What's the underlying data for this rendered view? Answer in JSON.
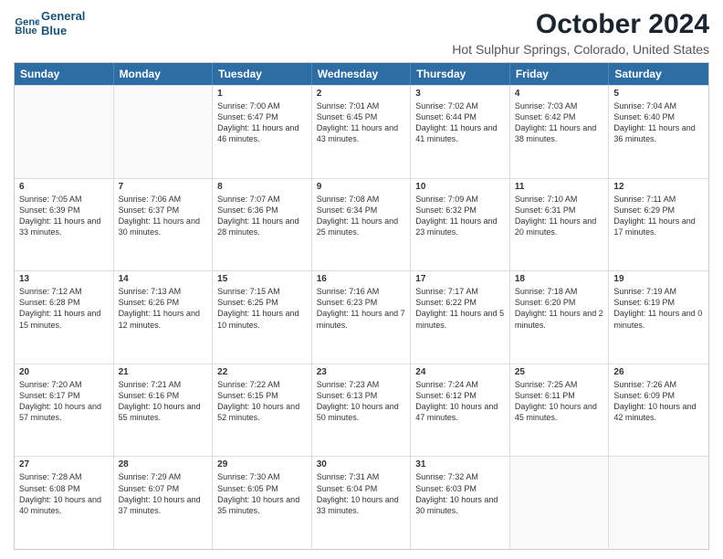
{
  "header": {
    "logo_line1": "General",
    "logo_line2": "Blue",
    "month": "October 2024",
    "location": "Hot Sulphur Springs, Colorado, United States"
  },
  "weekdays": [
    "Sunday",
    "Monday",
    "Tuesday",
    "Wednesday",
    "Thursday",
    "Friday",
    "Saturday"
  ],
  "rows": [
    [
      {
        "day": "",
        "sunrise": "",
        "sunset": "",
        "daylight": ""
      },
      {
        "day": "",
        "sunrise": "",
        "sunset": "",
        "daylight": ""
      },
      {
        "day": "1",
        "sunrise": "Sunrise: 7:00 AM",
        "sunset": "Sunset: 6:47 PM",
        "daylight": "Daylight: 11 hours and 46 minutes."
      },
      {
        "day": "2",
        "sunrise": "Sunrise: 7:01 AM",
        "sunset": "Sunset: 6:45 PM",
        "daylight": "Daylight: 11 hours and 43 minutes."
      },
      {
        "day": "3",
        "sunrise": "Sunrise: 7:02 AM",
        "sunset": "Sunset: 6:44 PM",
        "daylight": "Daylight: 11 hours and 41 minutes."
      },
      {
        "day": "4",
        "sunrise": "Sunrise: 7:03 AM",
        "sunset": "Sunset: 6:42 PM",
        "daylight": "Daylight: 11 hours and 38 minutes."
      },
      {
        "day": "5",
        "sunrise": "Sunrise: 7:04 AM",
        "sunset": "Sunset: 6:40 PM",
        "daylight": "Daylight: 11 hours and 36 minutes."
      }
    ],
    [
      {
        "day": "6",
        "sunrise": "Sunrise: 7:05 AM",
        "sunset": "Sunset: 6:39 PM",
        "daylight": "Daylight: 11 hours and 33 minutes."
      },
      {
        "day": "7",
        "sunrise": "Sunrise: 7:06 AM",
        "sunset": "Sunset: 6:37 PM",
        "daylight": "Daylight: 11 hours and 30 minutes."
      },
      {
        "day": "8",
        "sunrise": "Sunrise: 7:07 AM",
        "sunset": "Sunset: 6:36 PM",
        "daylight": "Daylight: 11 hours and 28 minutes."
      },
      {
        "day": "9",
        "sunrise": "Sunrise: 7:08 AM",
        "sunset": "Sunset: 6:34 PM",
        "daylight": "Daylight: 11 hours and 25 minutes."
      },
      {
        "day": "10",
        "sunrise": "Sunrise: 7:09 AM",
        "sunset": "Sunset: 6:32 PM",
        "daylight": "Daylight: 11 hours and 23 minutes."
      },
      {
        "day": "11",
        "sunrise": "Sunrise: 7:10 AM",
        "sunset": "Sunset: 6:31 PM",
        "daylight": "Daylight: 11 hours and 20 minutes."
      },
      {
        "day": "12",
        "sunrise": "Sunrise: 7:11 AM",
        "sunset": "Sunset: 6:29 PM",
        "daylight": "Daylight: 11 hours and 17 minutes."
      }
    ],
    [
      {
        "day": "13",
        "sunrise": "Sunrise: 7:12 AM",
        "sunset": "Sunset: 6:28 PM",
        "daylight": "Daylight: 11 hours and 15 minutes."
      },
      {
        "day": "14",
        "sunrise": "Sunrise: 7:13 AM",
        "sunset": "Sunset: 6:26 PM",
        "daylight": "Daylight: 11 hours and 12 minutes."
      },
      {
        "day": "15",
        "sunrise": "Sunrise: 7:15 AM",
        "sunset": "Sunset: 6:25 PM",
        "daylight": "Daylight: 11 hours and 10 minutes."
      },
      {
        "day": "16",
        "sunrise": "Sunrise: 7:16 AM",
        "sunset": "Sunset: 6:23 PM",
        "daylight": "Daylight: 11 hours and 7 minutes."
      },
      {
        "day": "17",
        "sunrise": "Sunrise: 7:17 AM",
        "sunset": "Sunset: 6:22 PM",
        "daylight": "Daylight: 11 hours and 5 minutes."
      },
      {
        "day": "18",
        "sunrise": "Sunrise: 7:18 AM",
        "sunset": "Sunset: 6:20 PM",
        "daylight": "Daylight: 11 hours and 2 minutes."
      },
      {
        "day": "19",
        "sunrise": "Sunrise: 7:19 AM",
        "sunset": "Sunset: 6:19 PM",
        "daylight": "Daylight: 11 hours and 0 minutes."
      }
    ],
    [
      {
        "day": "20",
        "sunrise": "Sunrise: 7:20 AM",
        "sunset": "Sunset: 6:17 PM",
        "daylight": "Daylight: 10 hours and 57 minutes."
      },
      {
        "day": "21",
        "sunrise": "Sunrise: 7:21 AM",
        "sunset": "Sunset: 6:16 PM",
        "daylight": "Daylight: 10 hours and 55 minutes."
      },
      {
        "day": "22",
        "sunrise": "Sunrise: 7:22 AM",
        "sunset": "Sunset: 6:15 PM",
        "daylight": "Daylight: 10 hours and 52 minutes."
      },
      {
        "day": "23",
        "sunrise": "Sunrise: 7:23 AM",
        "sunset": "Sunset: 6:13 PM",
        "daylight": "Daylight: 10 hours and 50 minutes."
      },
      {
        "day": "24",
        "sunrise": "Sunrise: 7:24 AM",
        "sunset": "Sunset: 6:12 PM",
        "daylight": "Daylight: 10 hours and 47 minutes."
      },
      {
        "day": "25",
        "sunrise": "Sunrise: 7:25 AM",
        "sunset": "Sunset: 6:11 PM",
        "daylight": "Daylight: 10 hours and 45 minutes."
      },
      {
        "day": "26",
        "sunrise": "Sunrise: 7:26 AM",
        "sunset": "Sunset: 6:09 PM",
        "daylight": "Daylight: 10 hours and 42 minutes."
      }
    ],
    [
      {
        "day": "27",
        "sunrise": "Sunrise: 7:28 AM",
        "sunset": "Sunset: 6:08 PM",
        "daylight": "Daylight: 10 hours and 40 minutes."
      },
      {
        "day": "28",
        "sunrise": "Sunrise: 7:29 AM",
        "sunset": "Sunset: 6:07 PM",
        "daylight": "Daylight: 10 hours and 37 minutes."
      },
      {
        "day": "29",
        "sunrise": "Sunrise: 7:30 AM",
        "sunset": "Sunset: 6:05 PM",
        "daylight": "Daylight: 10 hours and 35 minutes."
      },
      {
        "day": "30",
        "sunrise": "Sunrise: 7:31 AM",
        "sunset": "Sunset: 6:04 PM",
        "daylight": "Daylight: 10 hours and 33 minutes."
      },
      {
        "day": "31",
        "sunrise": "Sunrise: 7:32 AM",
        "sunset": "Sunset: 6:03 PM",
        "daylight": "Daylight: 10 hours and 30 minutes."
      },
      {
        "day": "",
        "sunrise": "",
        "sunset": "",
        "daylight": ""
      },
      {
        "day": "",
        "sunrise": "",
        "sunset": "",
        "daylight": ""
      }
    ]
  ]
}
